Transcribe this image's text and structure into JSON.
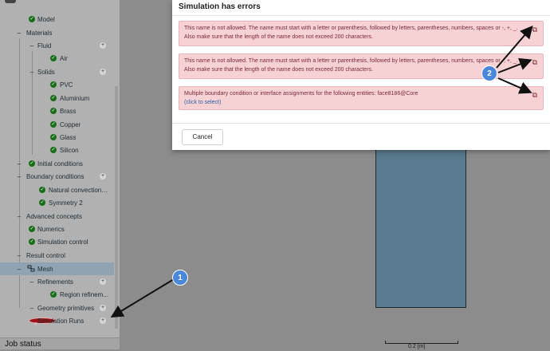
{
  "tree": [
    {
      "label": "Model",
      "status": "ok"
    },
    {
      "label": "Materials",
      "status": "none"
    },
    {
      "label": "Fluid",
      "status": "none"
    },
    {
      "label": "Air",
      "status": "ok"
    },
    {
      "label": "Solids",
      "status": "none"
    },
    {
      "label": "PVC",
      "status": "ok"
    },
    {
      "label": "Aluminium",
      "status": "ok"
    },
    {
      "label": "Brass",
      "status": "ok"
    },
    {
      "label": "Copper",
      "status": "ok"
    },
    {
      "label": "Glass",
      "status": "ok"
    },
    {
      "label": "Silicon",
      "status": "ok"
    },
    {
      "label": "Initial conditions",
      "status": "ok"
    },
    {
      "label": "Boundary conditions",
      "status": "none"
    },
    {
      "label": "Natural convection i...",
      "status": "ok"
    },
    {
      "label": "Symmetry 2",
      "status": "ok"
    },
    {
      "label": "Advanced concepts",
      "status": "none"
    },
    {
      "label": "Numerics",
      "status": "ok"
    },
    {
      "label": "Simulation control",
      "status": "ok"
    },
    {
      "label": "Result control",
      "status": "none"
    },
    {
      "label": "Mesh",
      "status": "mesh"
    },
    {
      "label": "Refinements",
      "status": "none"
    },
    {
      "label": "Region refinem...",
      "status": "ok"
    },
    {
      "label": "Geometry primitives",
      "status": "none"
    },
    {
      "label": "Simulation Runs",
      "status": "error"
    }
  ],
  "job_status_label": "Job status",
  "dialog": {
    "title": "Simulation has errors",
    "errors": [
      {
        "text": "This name is not allowed. The name must start with a letter or parenthesis, followed by letters, parentheses, numbers, spaces or -, +, _. Also make sure that the length of the name does not exceed 200 characters.",
        "link": ""
      },
      {
        "text": "This name is not allowed. The name must start with a letter or parenthesis, followed by letters, parentheses, numbers, spaces or -, +, _. Also make sure that the length of the name does not exceed 200 characters.",
        "link": ""
      },
      {
        "text": "Multiple boundary condition or interface assignments for the following entities: face8186@Core",
        "link": "(click to select)"
      }
    ],
    "cancel_label": "Cancel"
  },
  "scale_label": "0.2 [m]",
  "annotations": {
    "badge1": "1",
    "badge2": "2"
  },
  "colors": {
    "accent": "#4a87d8",
    "error_bg": "#f6d2d5",
    "status_ok": "#176e17",
    "status_error": "#9b1515"
  }
}
